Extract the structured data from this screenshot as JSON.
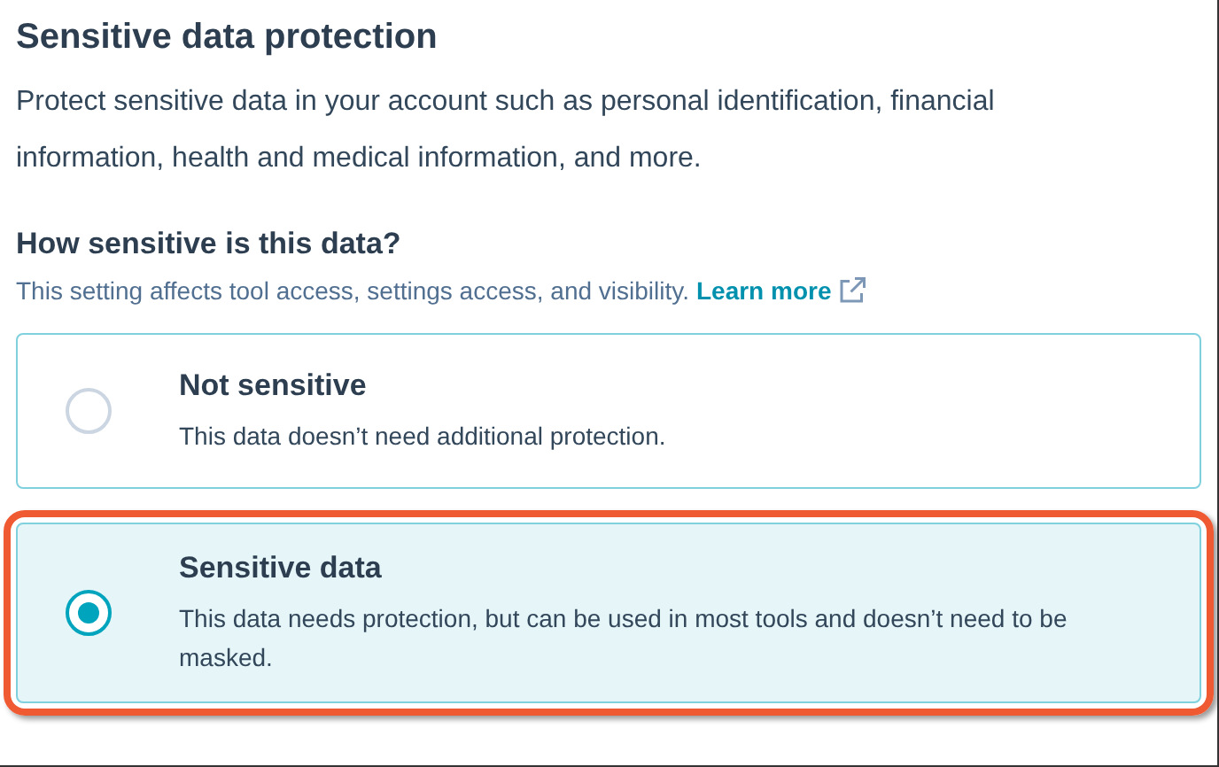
{
  "title": "Sensitive data protection",
  "description": "Protect sensitive data in your account such as personal identification, financial information, health and medical information, and more.",
  "question": {
    "heading": "How sensitive is this data?",
    "hint": "This setting affects tool access, settings access, and visibility.",
    "link": "Learn more"
  },
  "options": [
    {
      "label": "Not sensitive",
      "description": "This data doesn’t need additional protection.",
      "selected": false,
      "highlighted": false
    },
    {
      "label": "Sensitive data",
      "description": "This data needs protection, but can be used in most tools and doesn’t need to be masked.",
      "selected": true,
      "highlighted": true
    }
  ]
}
